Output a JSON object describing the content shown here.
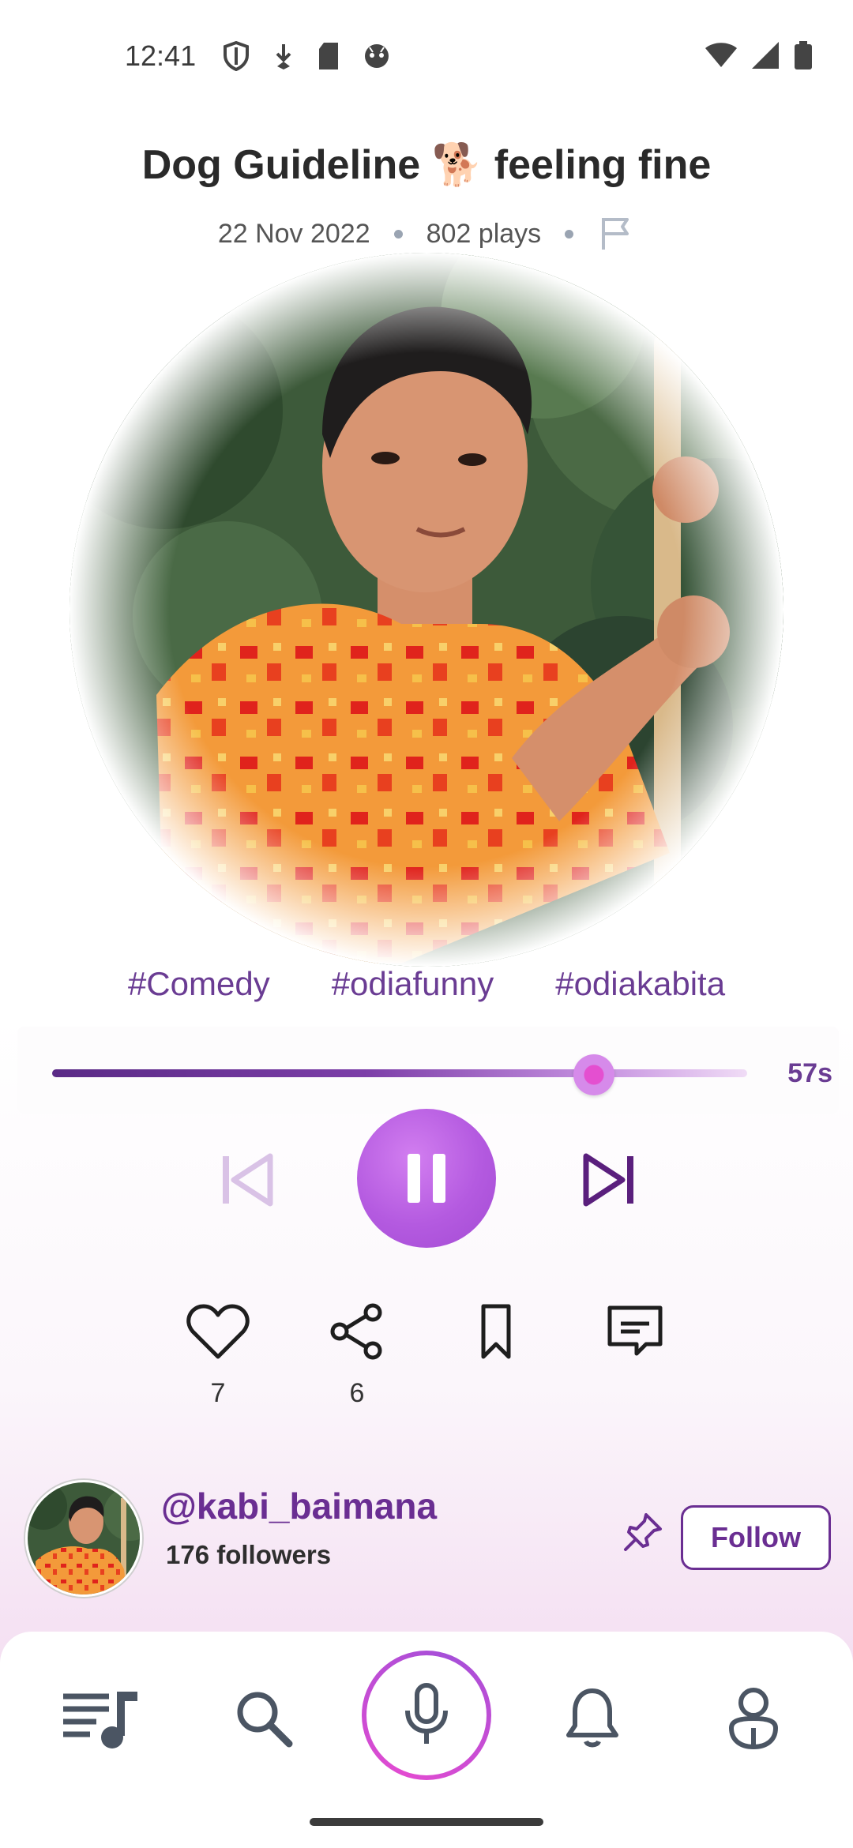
{
  "status_bar": {
    "time": "12:41",
    "left_icons": [
      "shield-icon",
      "download-icon",
      "sd-card-icon",
      "face-icon"
    ],
    "right_icons": [
      "wifi-icon",
      "signal-icon",
      "battery-icon"
    ]
  },
  "track": {
    "title": "Dog Guideline 🐕 feeling fine",
    "date": "22 Nov 2022",
    "plays": "802 plays"
  },
  "tags": [
    "#Comedy",
    "#odiafunny",
    "#odiakabita"
  ],
  "player": {
    "progress": 0.78,
    "remaining": "57s",
    "state": "playing"
  },
  "actions": {
    "likes": "7",
    "shares": "6"
  },
  "creator": {
    "handle": "@kabi_baimana",
    "followers": "176 followers",
    "follow_label": "Follow"
  },
  "nav": [
    "playlist-icon",
    "search-icon",
    "mic-icon",
    "bell-icon",
    "profile-icon"
  ],
  "colors": {
    "accent": "#6a2e92",
    "play_button": "#b45ae0",
    "mic_ring": "#e24bd1"
  }
}
